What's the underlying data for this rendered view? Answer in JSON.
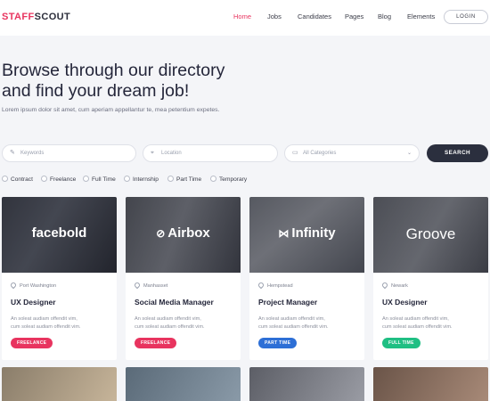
{
  "header": {
    "logo_part1": "STAFF",
    "logo_part2": "SCOUT",
    "nav": [
      "Home",
      "Jobs",
      "Candidates",
      "Pages",
      "Blog",
      "Elements"
    ],
    "active_nav": "Home",
    "login_label": "LOGIN"
  },
  "hero": {
    "title_line1": "Browse through our directory",
    "title_line2": "and find your dream job!",
    "subtitle": "Lorem ipsum dolor sit amet, cum aperiam appellantur te, mea petentium expetes."
  },
  "search": {
    "keywords_placeholder": "Keywords",
    "location_placeholder": "Location",
    "category_value": "All Categories",
    "button_label": "SEARCH"
  },
  "filters": [
    "Contract",
    "Freelance",
    "Full Time",
    "Internship",
    "Part Time",
    "Temporary"
  ],
  "jobs": [
    {
      "company": "facebold",
      "location": "Port Washington",
      "title": "UX Designer",
      "desc_line1": "An soleat audiam offendit vim,",
      "desc_line2": "cum soleat audiam offendit vim.",
      "tag": "FREELANCE",
      "tag_color": "#e8345f"
    },
    {
      "company": "Airbox",
      "location": "Manhasset",
      "title": "Social Media Manager",
      "desc_line1": "An soleat audiam offendit vim,",
      "desc_line2": "cum soleat audiam offendit vim.",
      "tag": "FREELANCE",
      "tag_color": "#e8345f"
    },
    {
      "company": "Infinity",
      "location": "Hempstead",
      "title": "Project Manager",
      "desc_line1": "An soleat audiam offendit vim,",
      "desc_line2": "cum soleat audiam offendit vim.",
      "tag": "PART TIME",
      "tag_color": "#2d6fd6"
    },
    {
      "company": "Groove",
      "location": "Newark",
      "title": "UX Designer",
      "desc_line1": "An soleat audiam offendit vim,",
      "desc_line2": "cum soleat audiam offendit vim.",
      "tag": "FULL TIME",
      "tag_color": "#1fbf83"
    }
  ],
  "colors": {
    "accent": "#e8345f",
    "dark_button": "#2b2f3e"
  }
}
